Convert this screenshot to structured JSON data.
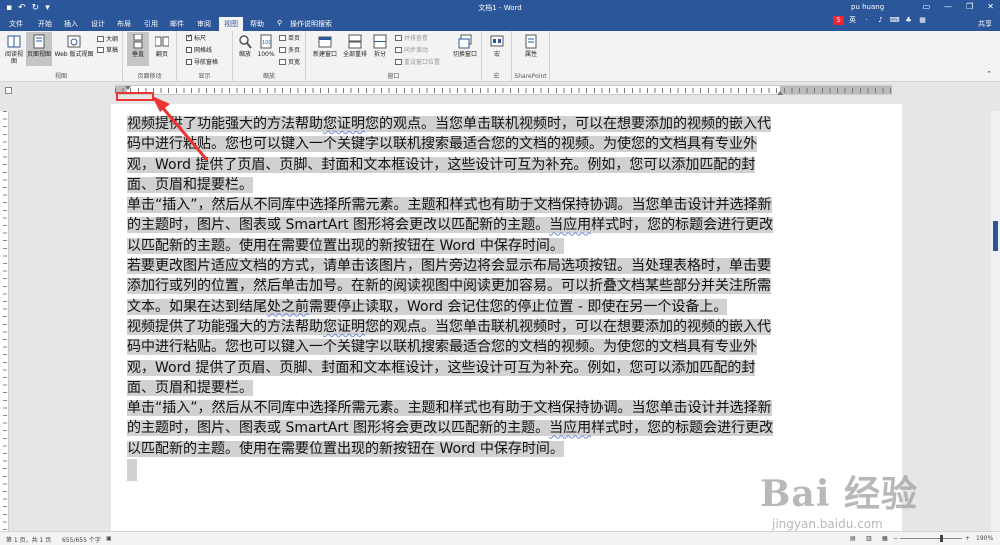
{
  "titlebar": {
    "title": "文档1 - Word",
    "user": "pu huang",
    "minimize": "—",
    "restore": "❐",
    "close": "✕"
  },
  "quick_access": {
    "save_icon": "save-icon",
    "undo_icon": "undo-icon",
    "redo_icon": "redo-icon"
  },
  "tabs": [
    "文件",
    "开始",
    "插入",
    "设计",
    "布局",
    "引用",
    "邮件",
    "审阅",
    "视图",
    "帮助"
  ],
  "active_tab": "视图",
  "tell_me": "操作说明搜索",
  "share": "共享",
  "ribbon": {
    "views": {
      "read_mode": "阅读视图",
      "print_layout": "页面视图",
      "web_layout": "Web 版式视图",
      "outline": "大纲",
      "draft": "草稿",
      "label": "视图"
    },
    "page_movement": {
      "vertical": "垂直",
      "side_to_side": "翻页",
      "label": "页面移动"
    },
    "show": {
      "ruler": "标尺",
      "gridlines": "网格线",
      "nav_pane": "导航窗格",
      "label": "显示"
    },
    "zoom": {
      "zoom": "缩放",
      "hundred": "100%",
      "one_page": "单页",
      "multiple_pages": "多页",
      "page_width": "页宽",
      "label": "缩放"
    },
    "window": {
      "new_window": "新建窗口",
      "arrange_all": "全部重排",
      "split": "拆分",
      "side_by_side": "并排查看",
      "sync_scroll": "同步滚动",
      "reset_position": "重设窗口位置",
      "switch_windows": "切换窗口",
      "label": "窗口"
    },
    "macros": {
      "macros": "宏",
      "label": "宏"
    },
    "sharepoint": {
      "properties": "属性",
      "label": "SharePoint"
    }
  },
  "document": {
    "paragraphs": [
      [
        {
          "t": "视频提供了功能强大的方法帮助"
        },
        {
          "t": "您证明",
          "sq": true
        },
        {
          "t": "您的观点。当您单击联机视频时，可以在想要添加的视频的嵌入代码中进行粘贴。您也可以键入一个关键字以联机搜索最适合您的文档的视频。为使您的文档具有专业外观，Word 提供了页眉、页脚、封面和文本框设计，这些设计可互为补充。例如，您可以添加匹配的封面、页眉和提要栏。"
        }
      ],
      [
        {
          "t": "单击“插入”，然后从不同库中选择所需元素。主题和样式也有助于文档保持协调。当您单击设计并选择新的主题时，图片、图表或 SmartArt 图形将会更改以匹配新的主题。"
        },
        {
          "t": "当应用",
          "sq": true
        },
        {
          "t": "样式时，您的标题会进行更改以匹配新的主题。使用在需要位置出现的新按钮在 Word 中保存时间。"
        }
      ],
      [
        {
          "t": "若要更改图片适应文档的方式，请单击该图片，图片旁边将会显示布局选项按钮。当处理表格时，单击要添加行或列的位置，然后单击加号。在新的阅读视图中阅读更加容易。可以折叠文档某些部分并关注所需文本。如果在达到结尾"
        },
        {
          "t": "处之前",
          "sq": true
        },
        {
          "t": "需要停止读取，Word 会记住您的停止位置 - 即使在另一个设备上。"
        }
      ],
      [
        {
          "t": "视频提供了功能强大的方法帮助"
        },
        {
          "t": "您证明",
          "sq": true
        },
        {
          "t": "您的观点。当您单击联机视频时，可以在想要添加的视频的嵌入代码中进行粘贴。您也可以键入一个关键字以联机搜索最适合您的文档的视频。为使您的文档具有专业外观，Word 提供了页眉、页脚、封面和文本框设计，这些设计可互为补充。例如，您可以添加匹配的封面、页眉和提要栏。"
        }
      ],
      [
        {
          "t": "单击“插入”，然后从不同库中选择所需元素。主题和样式也有助于文档保持协调。当您单击设计并选择新的主题时，图片、图表或 SmartArt 图形将会更改以匹配新的主题。"
        },
        {
          "t": "当应用",
          "sq": true
        },
        {
          "t": "样式时，您的标题会进行更改以匹配新的主题。使用在需要位置出现的新按钮在 Word 中保存时间。"
        }
      ]
    ]
  },
  "statusbar": {
    "page": "第 1 页，共 1 页",
    "words": "655/655 个字",
    "zoom": "190%",
    "minus": "−",
    "plus": "+"
  },
  "watermark": {
    "main": "Bai 经验",
    "sub": "jingyan.baidu.com"
  },
  "colors": {
    "brand": "#2b579a",
    "selection": "#d1d1d1",
    "annotation": "#ee3333"
  }
}
